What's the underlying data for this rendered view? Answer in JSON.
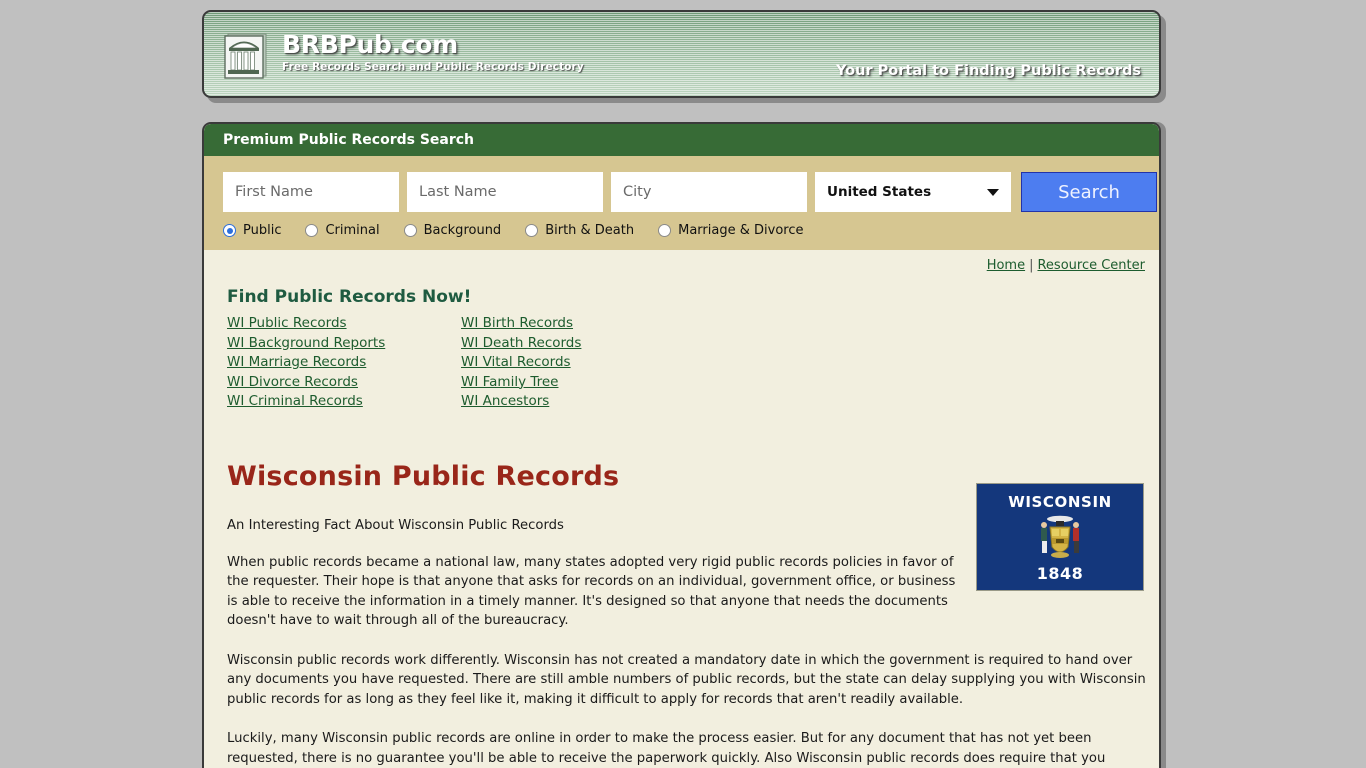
{
  "banner": {
    "logo_icon": "classical-building-icon",
    "brand_title": "BRBPub.com",
    "brand_subtitle": "Free Records Search and Public Records Directory",
    "tagline": "Your Portal to Finding Public Records",
    "colors": {
      "gradient_top": "#6f9a77",
      "gradient_bottom": "#bdd5c0",
      "border": "#3a3a3a"
    }
  },
  "search": {
    "header_title": "Premium Public Records Search",
    "header_bg": "#376b36",
    "panel_bg": "#d6c691",
    "fields": {
      "first_name_placeholder": "First Name",
      "first_name_value": "",
      "last_name_placeholder": "Last Name",
      "last_name_value": "",
      "city_placeholder": "City",
      "city_value": ""
    },
    "country": {
      "selected": "United States",
      "caret_icon": "chevron-down-icon"
    },
    "search_button_label": "Search",
    "search_button_color": "#4d7df0",
    "record_types": [
      {
        "label": "Public",
        "checked": true
      },
      {
        "label": "Criminal",
        "checked": false
      },
      {
        "label": "Background",
        "checked": false
      },
      {
        "label": "Birth & Death",
        "checked": false
      },
      {
        "label": "Marriage & Divorce",
        "checked": false
      }
    ]
  },
  "nav": {
    "home": "Home",
    "separator": "|",
    "resource_center": "Resource Center"
  },
  "find_records": {
    "title": "Find Public Records Now!",
    "column_left": [
      "WI Public Records",
      "WI Background Reports",
      "WI Marriage Records",
      "WI Divorce Records",
      "WI Criminal Records"
    ],
    "column_right": [
      "WI Birth Records",
      "WI Death Records",
      "WI Vital Records",
      "WI Family Tree",
      "WI Ancestors"
    ],
    "link_color": "#1d5c2e"
  },
  "article": {
    "title": "Wisconsin Public Records",
    "title_color": "#992619",
    "lead": "An Interesting Fact About Wisconsin Public Records",
    "paragraphs": [
      "When public records became a national law, many states adopted very rigid public records policies in favor of the requester. Their hope is that anyone that asks for records on an individual, government office, or business is able to receive the information in a timely manner. It's designed so that anyone that needs the documents doesn't have to wait through all of the bureaucracy.",
      "Wisconsin public records work differently. Wisconsin has not created a mandatory date in which the government is required to hand over any documents you have requested. There are still amble numbers of public records, but the state can delay supplying you with Wisconsin public records for as long as they feel like it, making it difficult to apply for records that aren't readily available.",
      "Luckily, many Wisconsin public records are online in order to make the process easier. But for any document that has not yet been requested, there is no guarantee you'll be able to receive the paperwork quickly. Also Wisconsin public records does require that you"
    ]
  },
  "flag": {
    "state_name": "WISCONSIN",
    "year": "1848",
    "background": "#14377c",
    "icon": "wisconsin-state-flag"
  }
}
